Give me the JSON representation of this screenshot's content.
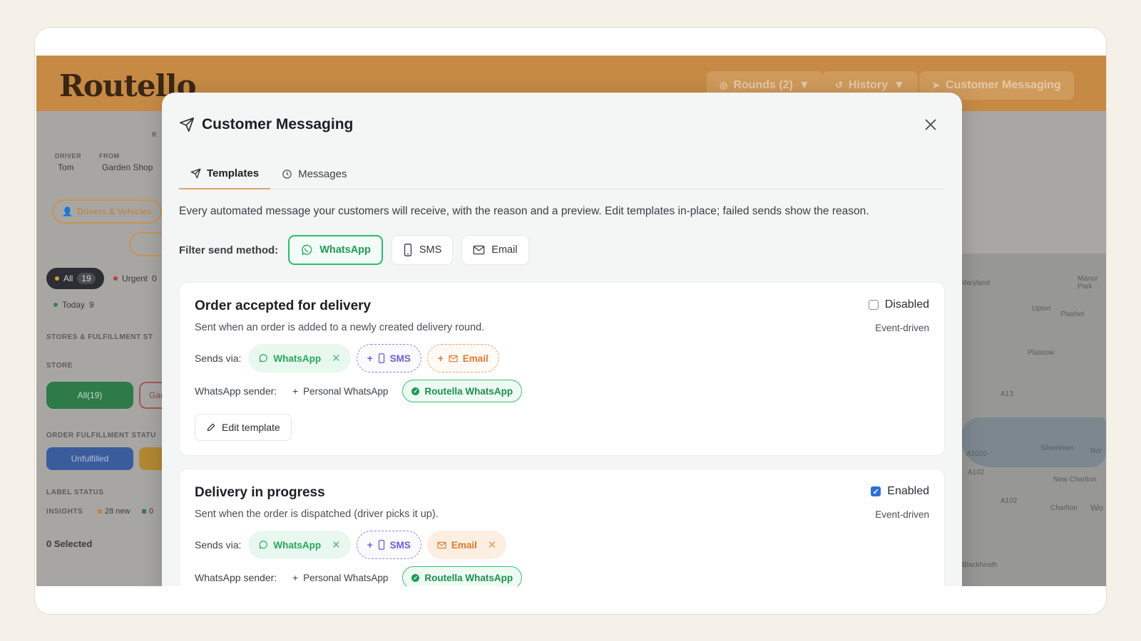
{
  "app": {
    "logo_text": "Routello",
    "header_buttons": {
      "rounds": "Rounds (2)",
      "history": "History",
      "messaging": "Customer Messaging"
    },
    "sidebar": {
      "driver_label": "DRIVER",
      "driver_value": "Tom",
      "from_label": "FROM",
      "from_value": "Garden Shop",
      "r_fragment": "R",
      "drivers_btn": "Drivers & Vehicles",
      "all_label": "All",
      "all_count": "19",
      "urgent_label": "Urgent",
      "urgent_count": "0",
      "today_label": "Today",
      "today_count": "9",
      "stores_heading": "STORES & FULFILLMENT ST",
      "store_label": "STORE",
      "store_all": "All(19)",
      "store_gar": "Gar",
      "order_status_heading": "ORDER FULFILLMENT STATU",
      "unfulfilled": "Unfulfilled",
      "label_status": "LABEL STATUS",
      "insights": "INSIGHTS",
      "insights_new": "28 new",
      "insights_zero": "0",
      "selected": "0 Selected"
    },
    "map_labels": [
      "Maryland",
      "Manor Park",
      "Upton",
      "Plashet",
      "Plaistow",
      "A13",
      "Silvertown",
      "Nor",
      "A102",
      "New Charlton",
      "A102",
      "Charlton",
      "Wo",
      "Blackheath",
      "A1020"
    ]
  },
  "modal": {
    "title": "Customer Messaging",
    "close_label": "×",
    "tabs": [
      {
        "label": "Templates"
      },
      {
        "label": "Messages"
      }
    ],
    "description": "Every automated message your customers will receive, with the reason and a preview. Edit templates in-place; failed sends show the reason.",
    "filter": {
      "label": "Filter send method:",
      "options": [
        {
          "label": "WhatsApp"
        },
        {
          "label": "SMS"
        },
        {
          "label": "Email"
        }
      ]
    },
    "templates": [
      {
        "title": "Order accepted for delivery",
        "subtitle": "Sent when an order is added to a newly created delivery round.",
        "status_label": "Disabled",
        "enabled": false,
        "trigger": "Event-driven",
        "sends_via_label": "Sends via:",
        "channels": {
          "whatsapp": "WhatsApp",
          "sms": "SMS",
          "email": "Email"
        },
        "sender_label": "WhatsApp sender:",
        "senders": {
          "personal": "Personal WhatsApp",
          "routella": "Routella WhatsApp"
        },
        "edit_label": "Edit template"
      },
      {
        "title": "Delivery in progress",
        "subtitle": "Sent when the order is dispatched (driver picks it up).",
        "status_label": "Enabled",
        "enabled": true,
        "trigger": "Event-driven",
        "sends_via_label": "Sends via:",
        "channels": {
          "whatsapp": "WhatsApp",
          "sms": "SMS",
          "email": "Email"
        },
        "sender_label": "WhatsApp sender:",
        "senders": {
          "personal": "Personal WhatsApp",
          "routella": "Routella WhatsApp"
        }
      }
    ]
  },
  "colors": {
    "brand_orange": "#c68a45",
    "whatsapp_green": "#26a85c",
    "sms_purple": "#6a5fd8",
    "email_orange": "#df7a2c",
    "enabled_blue": "#2f6fd8"
  }
}
